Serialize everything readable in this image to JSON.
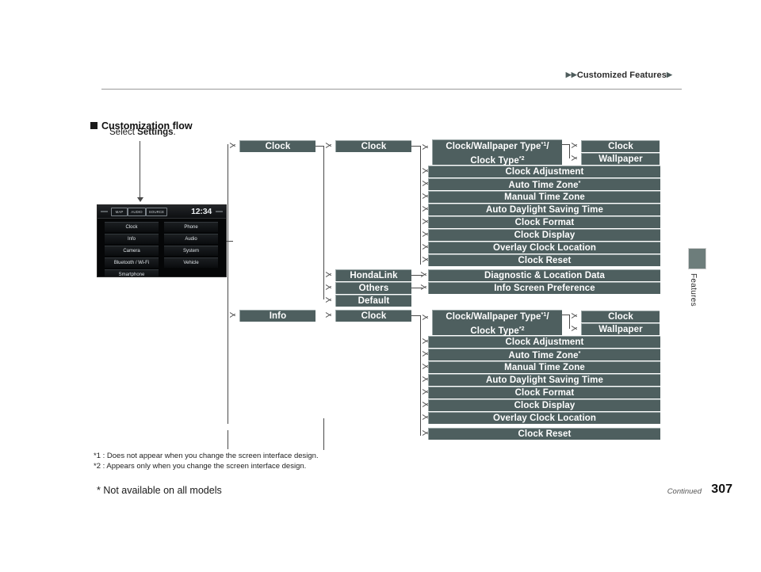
{
  "header": {
    "breadcrumb": "Customized Features",
    "arrow_left": "▶▶",
    "arrow_right": "▶"
  },
  "section": {
    "title": "Customization flow"
  },
  "instruction": {
    "prefix": "Select ",
    "bold": "Settings",
    "suffix": "."
  },
  "nav_screen": {
    "tabs": [
      "MAP",
      "AUDIO",
      "SOURCE"
    ],
    "clock": "12:34",
    "buttons_left": [
      "Clock",
      "Info",
      "Camera",
      "Bluetooth / Wi-Fi",
      "Smartphone"
    ],
    "buttons_right": [
      "Phone",
      "Audio",
      "System",
      "Vehicle"
    ]
  },
  "flow": {
    "col1": [
      {
        "label": "Clock"
      },
      {
        "label": "Info"
      }
    ],
    "col2_upper": [
      {
        "label": "Clock"
      },
      {
        "label": "HondaLink"
      },
      {
        "label": "Others"
      },
      {
        "label": "Default"
      }
    ],
    "col2_lower": [
      {
        "label": "Clock"
      }
    ],
    "col3_upper": [
      {
        "label": "Clock/Wallpaper Type",
        "sup1": "*1",
        "label2": "Clock Type",
        "sup2": "*2",
        "two_line": true
      },
      {
        "label": "Clock Adjustment"
      },
      {
        "label": "Auto Time Zone",
        "sup1": "*"
      },
      {
        "label": "Manual Time Zone"
      },
      {
        "label": "Auto Daylight Saving Time"
      },
      {
        "label": "Clock Format"
      },
      {
        "label": "Clock Display"
      },
      {
        "label": "Overlay Clock Location"
      },
      {
        "label": "Clock Reset"
      },
      {
        "label": "Diagnostic & Location Data"
      },
      {
        "label": "Info Screen Preference"
      }
    ],
    "col3_lower": [
      {
        "label": "Clock/Wallpaper Type",
        "sup1": "*1",
        "label2": "Clock Type",
        "sup2": "*2",
        "two_line": true
      },
      {
        "label": "Clock Adjustment"
      },
      {
        "label": "Auto Time Zone",
        "sup1": "*"
      },
      {
        "label": "Manual Time Zone"
      },
      {
        "label": "Auto Daylight Saving Time"
      },
      {
        "label": "Clock Format"
      },
      {
        "label": "Clock Display"
      },
      {
        "label": "Overlay Clock Location"
      },
      {
        "label": "Clock Reset"
      }
    ],
    "col4_upper": [
      {
        "label": "Clock"
      },
      {
        "label": "Wallpaper"
      }
    ],
    "col4_lower": [
      {
        "label": "Clock"
      },
      {
        "label": "Wallpaper"
      }
    ]
  },
  "footnotes": {
    "note1": "*1 : Does not appear when you change the screen interface design.",
    "note2": "*2 : Appears only when you change the screen interface design.",
    "not_available": "* Not available on all models"
  },
  "footer": {
    "continued": "Continued",
    "page_number": "307"
  },
  "side_tab": {
    "label": "Features"
  },
  "colors": {
    "box_fill": "#4e5f5f",
    "box_highlight": "#9aa6a6",
    "line": "#4a4a4a",
    "tab_fill": "#6d7d7b"
  }
}
